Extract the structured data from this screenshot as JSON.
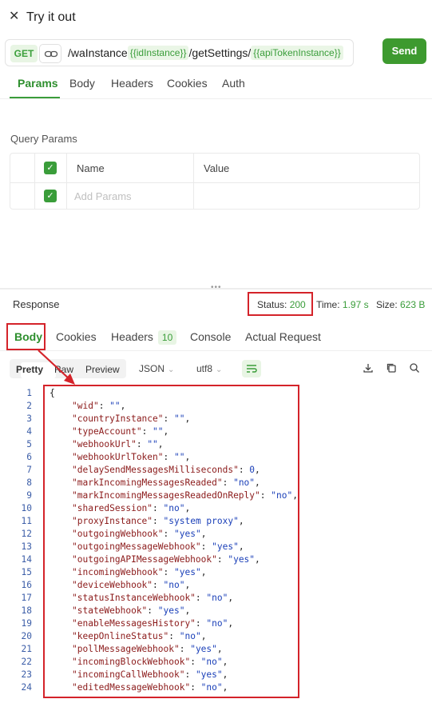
{
  "header": {
    "title": "Try it out",
    "close_icon": "close-icon"
  },
  "request": {
    "method": "GET",
    "url_parts": [
      {
        "type": "text",
        "value": "/waInstance"
      },
      {
        "type": "var",
        "value": "{{idInstance}}"
      },
      {
        "type": "text",
        "value": "/getSettings/"
      },
      {
        "type": "var",
        "value": "{{apiTokenInstance}}"
      }
    ],
    "send_label": "Send"
  },
  "request_tabs": [
    "Params",
    "Body",
    "Headers",
    "Cookies",
    "Auth"
  ],
  "query_params": {
    "label": "Query Params",
    "col_name": "Name",
    "col_value": "Value",
    "placeholder": "Add Params"
  },
  "response": {
    "label": "Response",
    "status_label": "Status:",
    "status_value": "200",
    "time_label": "Time:",
    "time_value": "1.97 s",
    "size_label": "Size:",
    "size_value": "623 B"
  },
  "response_tabs": [
    {
      "label": "Body"
    },
    {
      "label": "Cookies"
    },
    {
      "label": "Headers",
      "badge": "10"
    },
    {
      "label": "Console"
    },
    {
      "label": "Actual Request"
    }
  ],
  "view_modes": [
    "Pretty",
    "Raw",
    "Preview"
  ],
  "format": "JSON",
  "encoding": "utf8",
  "accent_color": "#3d9a2f",
  "highlight_color": "#d4232a",
  "code_lines": [
    {
      "ln": "1",
      "key": "",
      "val": "",
      "raw": "{"
    },
    {
      "ln": "2",
      "key": "\"wid\"",
      "val": "\"\"",
      "type": "s"
    },
    {
      "ln": "3",
      "key": "\"countryInstance\"",
      "val": "\"\"",
      "type": "s"
    },
    {
      "ln": "4",
      "key": "\"typeAccount\"",
      "val": "\"\"",
      "type": "s"
    },
    {
      "ln": "5",
      "key": "\"webhookUrl\"",
      "val": "\"\"",
      "type": "s"
    },
    {
      "ln": "6",
      "key": "\"webhookUrlToken\"",
      "val": "\"\"",
      "type": "s"
    },
    {
      "ln": "7",
      "key": "\"delaySendMessagesMilliseconds\"",
      "val": "0",
      "type": "n"
    },
    {
      "ln": "8",
      "key": "\"markIncomingMessagesReaded\"",
      "val": "\"no\"",
      "type": "s"
    },
    {
      "ln": "9",
      "key": "\"markIncomingMessagesReadedOnReply\"",
      "val": "\"no\"",
      "type": "s"
    },
    {
      "ln": "10",
      "key": "\"sharedSession\"",
      "val": "\"no\"",
      "type": "s"
    },
    {
      "ln": "11",
      "key": "\"proxyInstance\"",
      "val": "\"system proxy\"",
      "type": "s"
    },
    {
      "ln": "12",
      "key": "\"outgoingWebhook\"",
      "val": "\"yes\"",
      "type": "s"
    },
    {
      "ln": "13",
      "key": "\"outgoingMessageWebhook\"",
      "val": "\"yes\"",
      "type": "s"
    },
    {
      "ln": "14",
      "key": "\"outgoingAPIMessageWebhook\"",
      "val": "\"yes\"",
      "type": "s"
    },
    {
      "ln": "15",
      "key": "\"incomingWebhook\"",
      "val": "\"yes\"",
      "type": "s"
    },
    {
      "ln": "16",
      "key": "\"deviceWebhook\"",
      "val": "\"no\"",
      "type": "s"
    },
    {
      "ln": "17",
      "key": "\"statusInstanceWebhook\"",
      "val": "\"no\"",
      "type": "s"
    },
    {
      "ln": "18",
      "key": "\"stateWebhook\"",
      "val": "\"yes\"",
      "type": "s"
    },
    {
      "ln": "19",
      "key": "\"enableMessagesHistory\"",
      "val": "\"no\"",
      "type": "s"
    },
    {
      "ln": "20",
      "key": "\"keepOnlineStatus\"",
      "val": "\"no\"",
      "type": "s"
    },
    {
      "ln": "21",
      "key": "\"pollMessageWebhook\"",
      "val": "\"yes\"",
      "type": "s"
    },
    {
      "ln": "22",
      "key": "\"incomingBlockWebhook\"",
      "val": "\"no\"",
      "type": "s"
    },
    {
      "ln": "23",
      "key": "\"incomingCallWebhook\"",
      "val": "\"yes\"",
      "type": "s"
    },
    {
      "ln": "24",
      "key": "\"editedMessageWebhook\"",
      "val": "\"no\"",
      "type": "s"
    }
  ]
}
